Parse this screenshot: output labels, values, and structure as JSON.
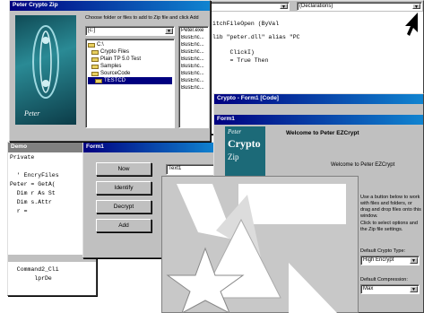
{
  "editor": {
    "title": "",
    "dropdown_value": "(Declarations)",
    "code_lines": [
      "itchFileOpen (ByVal",
      "lib \"peter.dll\" alias \"PC",
      "     ClickI)",
      "     = True Then",
      "     ",
      "     "
    ]
  },
  "file_dialog": {
    "title": "Peter Crypto Zip",
    "instruction": "Choose folder or files to add to Zip file and click Add",
    "drive_value": "[c:]",
    "folders": [
      {
        "label": "C:\\"
      },
      {
        "label": "Crypto Files"
      },
      {
        "label": "Plain TP 5.0 Test"
      },
      {
        "label": "Samples"
      },
      {
        "label": "SourceCode"
      },
      {
        "label": "TESTCD"
      }
    ],
    "files": [
      "Peter.exe",
      "BusEnc...",
      "BusEnc...",
      "BusEnc...",
      "BusEnc...",
      "BusEnc...",
      "BusEnc...",
      "BusEnc...",
      "BusEnc..."
    ]
  },
  "left_code": {
    "header": "Demo",
    "lines": [
      "Private",
      "",
      "  ' EncryFiles",
      "Peter = GetA(",
      "  Dim r As St",
      "  Dim s.Attr",
      "  r = ",
      "  ",
      "  "
    ],
    "lower": "  Command2_Cli",
    "lower2": "       lprDe"
  },
  "form_window": {
    "title": "Form1",
    "buttons": [
      "Now",
      "Identify",
      "Decrypt",
      "Add"
    ],
    "input_value": "Text1"
  },
  "peter_window": {
    "outer_title": "Crypto - Form1 [Code]",
    "inner_title": "Form1",
    "brand_top": "Peter",
    "brand_main": "Crypto",
    "brand_sub": "Zip",
    "welcome_heading": "Welcome to Peter EZCrypt",
    "welcome_text": "Welcome to Peter EZCrypt",
    "info_text": "Use a button below to work with files and folders, or drag and drop files onto this window.",
    "options_text": "Click to select options and the Zip file settings.",
    "select_label": "Default Crypto Type:",
    "select_value": "High Encrypt",
    "select2_label": "Default Compression:",
    "select2_value": "Max"
  },
  "colors": {
    "titlebar": "#000080",
    "brand_teal": "#1c6a78",
    "desktop_gray": "#c0c0c0"
  }
}
